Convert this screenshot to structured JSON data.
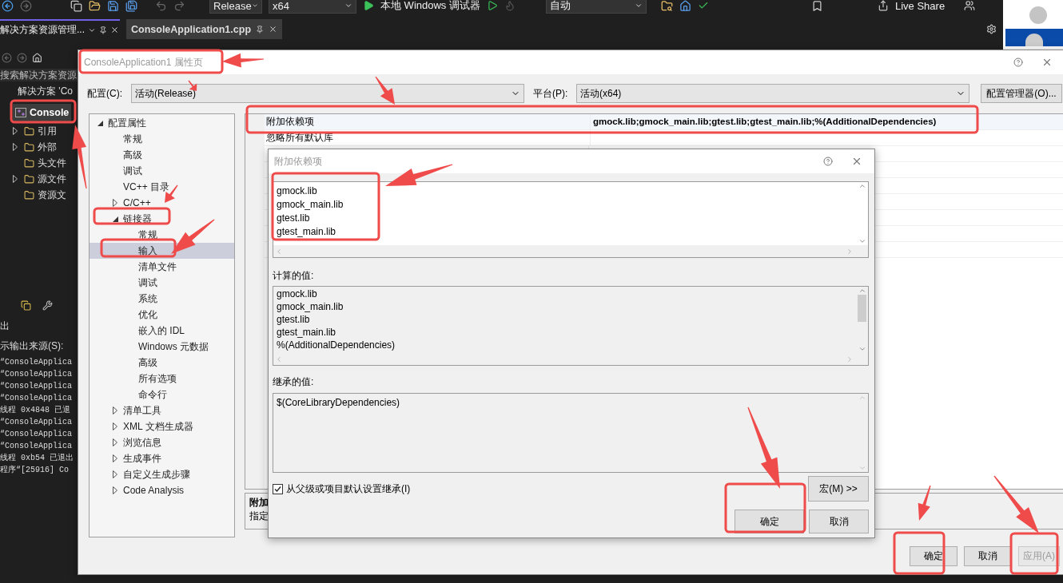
{
  "ide": {
    "toolbar": {
      "configuration": "Release",
      "platform": "x64",
      "debugger": "本地 Windows 调试器",
      "mode": "自动",
      "live_share": "Live Share"
    },
    "panel_tab": "解决方案资源管理...",
    "editor_tab": "ConsoleApplication1.cpp",
    "search_placeholder": "搜索解决方案资源",
    "solution": "解决方案 'Co",
    "project": {
      "label": "Console",
      "selected": true
    },
    "tree": [
      {
        "label": "引用",
        "expanded": false
      },
      {
        "label": "外部",
        "expanded": false
      },
      {
        "label": "头文件"
      },
      {
        "label": "源文件",
        "expanded": false
      },
      {
        "label": "资源文"
      }
    ],
    "output": {
      "title": "出",
      "source_label": "示输出来源(S):",
      "lines": [
        "“ConsoleApplica",
        "“ConsoleApplica",
        "“ConsoleApplica",
        "“ConsoleApplica",
        "线程 0x4848 已退",
        "“ConsoleApplica",
        "“ConsoleApplica",
        "“ConsoleApplica",
        "线程 0xb54 已退出",
        "程序“[25916] Co"
      ]
    }
  },
  "properties_dialog": {
    "title": "ConsoleApplication1 属性页",
    "config_label": "配置(C):",
    "config_value": "活动(Release)",
    "platform_label": "平台(P):",
    "platform_value": "活动(x64)",
    "manager_button": "配置管理器(O)...",
    "tree": [
      {
        "label": "配置属性",
        "expanded": true,
        "selected": false,
        "children": [
          {
            "label": "常规",
            "selected": false
          },
          {
            "label": "高级",
            "selected": false
          },
          {
            "label": "调试",
            "selected": false
          },
          {
            "label": "VC++ 目录",
            "selected": false
          },
          {
            "label": "C/C++",
            "expanded": false,
            "selected": false
          },
          {
            "label": "链接器",
            "expanded": true,
            "selected": false,
            "children": [
              {
                "label": "常规",
                "selected": false
              },
              {
                "label": "输入",
                "selected": true
              },
              {
                "label": "清单文件",
                "selected": false
              },
              {
                "label": "调试",
                "selected": false
              },
              {
                "label": "系统",
                "selected": false
              },
              {
                "label": "优化",
                "selected": false
              },
              {
                "label": "嵌入的 IDL",
                "selected": false
              },
              {
                "label": "Windows 元数据",
                "selected": false
              },
              {
                "label": "高级",
                "selected": false
              },
              {
                "label": "所有选项",
                "selected": false
              },
              {
                "label": "命令行",
                "selected": false
              }
            ]
          },
          {
            "label": "清单工具",
            "expanded": false,
            "selected": false
          },
          {
            "label": "XML 文档生成器",
            "expanded": false,
            "selected": false
          },
          {
            "label": "浏览信息",
            "expanded": false,
            "selected": false
          },
          {
            "label": "生成事件",
            "expanded": false,
            "selected": false
          },
          {
            "label": "自定义生成步骤",
            "expanded": false,
            "selected": false
          },
          {
            "label": "Code Analysis",
            "expanded": false,
            "selected": false
          }
        ]
      }
    ],
    "grid": [
      {
        "name": "附加依赖项",
        "value": "gmock.lib;gmock_main.lib;gtest.lib;gtest_main.lib;%(AdditionalDependencies)",
        "selected": true
      },
      {
        "name": "忽略所有默认库",
        "selected": false
      }
    ],
    "description": {
      "title": "附加",
      "text": "指定"
    },
    "buttons": [
      {
        "label": "确定",
        "disabled": false
      },
      {
        "label": "取消",
        "disabled": false
      },
      {
        "label": "应用(A)",
        "disabled": true
      }
    ]
  },
  "dependencies_dialog": {
    "title": "附加依赖项",
    "lines": [
      "gmock.lib",
      "gmock_main.lib",
      "gtest.lib",
      "gtest_main.lib"
    ],
    "computed_label": "计算的值:",
    "computed": [
      "gmock.lib",
      "gmock_main.lib",
      "gtest.lib",
      "gtest_main.lib",
      "%(AdditionalDependencies)"
    ],
    "inherited_label": "继承的值:",
    "inherited": [
      "$(CoreLibraryDependencies)"
    ],
    "inherit": {
      "label": "从父级或项目默认设置继承(I)",
      "checked": true
    },
    "macro_button": "宏(M) >>",
    "buttons": [
      {
        "label": "确定"
      },
      {
        "label": "取消"
      }
    ]
  }
}
